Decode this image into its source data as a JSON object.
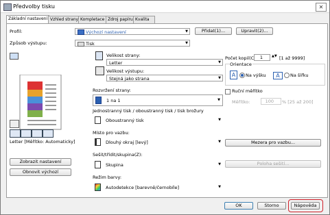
{
  "window": {
    "title": "Předvolby tisku"
  },
  "tabs": [
    "Základní nastavení",
    "Vzhled strany",
    "Kompletace",
    "Zdroj papíru",
    "Kvalita"
  ],
  "profile": {
    "label": "Profil:",
    "value": "Výchozí nastavení",
    "add_button": "Přidat(1)...",
    "edit_button": "Upravit(2)..."
  },
  "output_method": {
    "label": "Způsob výstupu:",
    "value": "Tisk"
  },
  "preview": {
    "paper_caption": "Letter [Měřítko: Automaticky]"
  },
  "page_size": {
    "label": "Velikost strany:",
    "value": "Letter"
  },
  "output_size": {
    "label": "Velikost výstupu:",
    "value": "Stejná jako strana"
  },
  "copies": {
    "label": "Počet kopií(C):",
    "value": "1",
    "range": "[1 až 9999]"
  },
  "orientation": {
    "label": "Orientace",
    "portrait": "Na výšku",
    "landscape": "Na šířku",
    "portrait_letter": "A",
    "landscape_letter": "A"
  },
  "layout": {
    "label": "Rozvržení strany:",
    "value": "1 na 1"
  },
  "manual_scale": {
    "label": "Ruční měřítko",
    "scale_label": "Měřítko:",
    "scale_value": "100",
    "scale_range": "% [25 až 200]"
  },
  "duplex": {
    "label": "Jednostranný tisk / oboustranný tisk / tisk brožury",
    "value": "Oboustranný tisk"
  },
  "binding": {
    "label": "Místo pro vazbu:",
    "value": "Dlouhý okraj [levý]",
    "margin_button": "Mezera pro vazbu..."
  },
  "finishing": {
    "label": "Sešit/třídit/skupina(Z):",
    "value": "Skupina",
    "staple_button": "Poloha sešití..."
  },
  "color_mode": {
    "label": "Režim barvy:",
    "value": "Autodetekce [barevně/černobíle]"
  },
  "buttons": {
    "show_settings": "Zobrazit nastavení",
    "restore_defaults": "Obnovit výchozí",
    "ok": "OK",
    "cancel": "Storno",
    "help": "Nápověda"
  },
  "colors": {
    "accent_blue": "#2a5fb0",
    "highlight_red": "#d1202a"
  }
}
